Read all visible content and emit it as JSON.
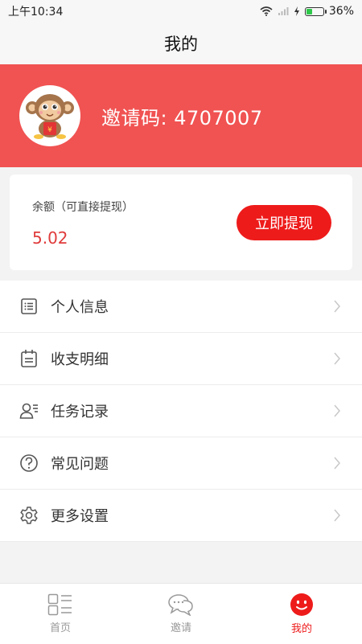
{
  "status_bar": {
    "time": "上午10:34",
    "battery": "36%",
    "battery_level": 0.36
  },
  "nav": {
    "title": "我的"
  },
  "profile": {
    "invite_code_label": "邀请码: 4707007"
  },
  "balance": {
    "label": "余额（可直接提现）",
    "value": "5.02",
    "withdraw_label": "立即提现"
  },
  "menu": {
    "items": [
      {
        "label": "个人信息",
        "icon": "list-icon"
      },
      {
        "label": "收支明细",
        "icon": "calendar-icon"
      },
      {
        "label": "任务记录",
        "icon": "user-tasks-icon"
      },
      {
        "label": "常见问题",
        "icon": "question-icon"
      },
      {
        "label": "更多设置",
        "icon": "gear-icon"
      }
    ]
  },
  "tabbar": {
    "items": [
      {
        "label": "首页",
        "icon": "home-grid-icon",
        "active": false
      },
      {
        "label": "邀请",
        "icon": "chat-bubbles-icon",
        "active": false
      },
      {
        "label": "我的",
        "icon": "smile-icon",
        "active": true
      }
    ]
  },
  "colors": {
    "accent": "#f05352",
    "button": "#ee1b1b",
    "balance_text": "#e03b3b"
  }
}
